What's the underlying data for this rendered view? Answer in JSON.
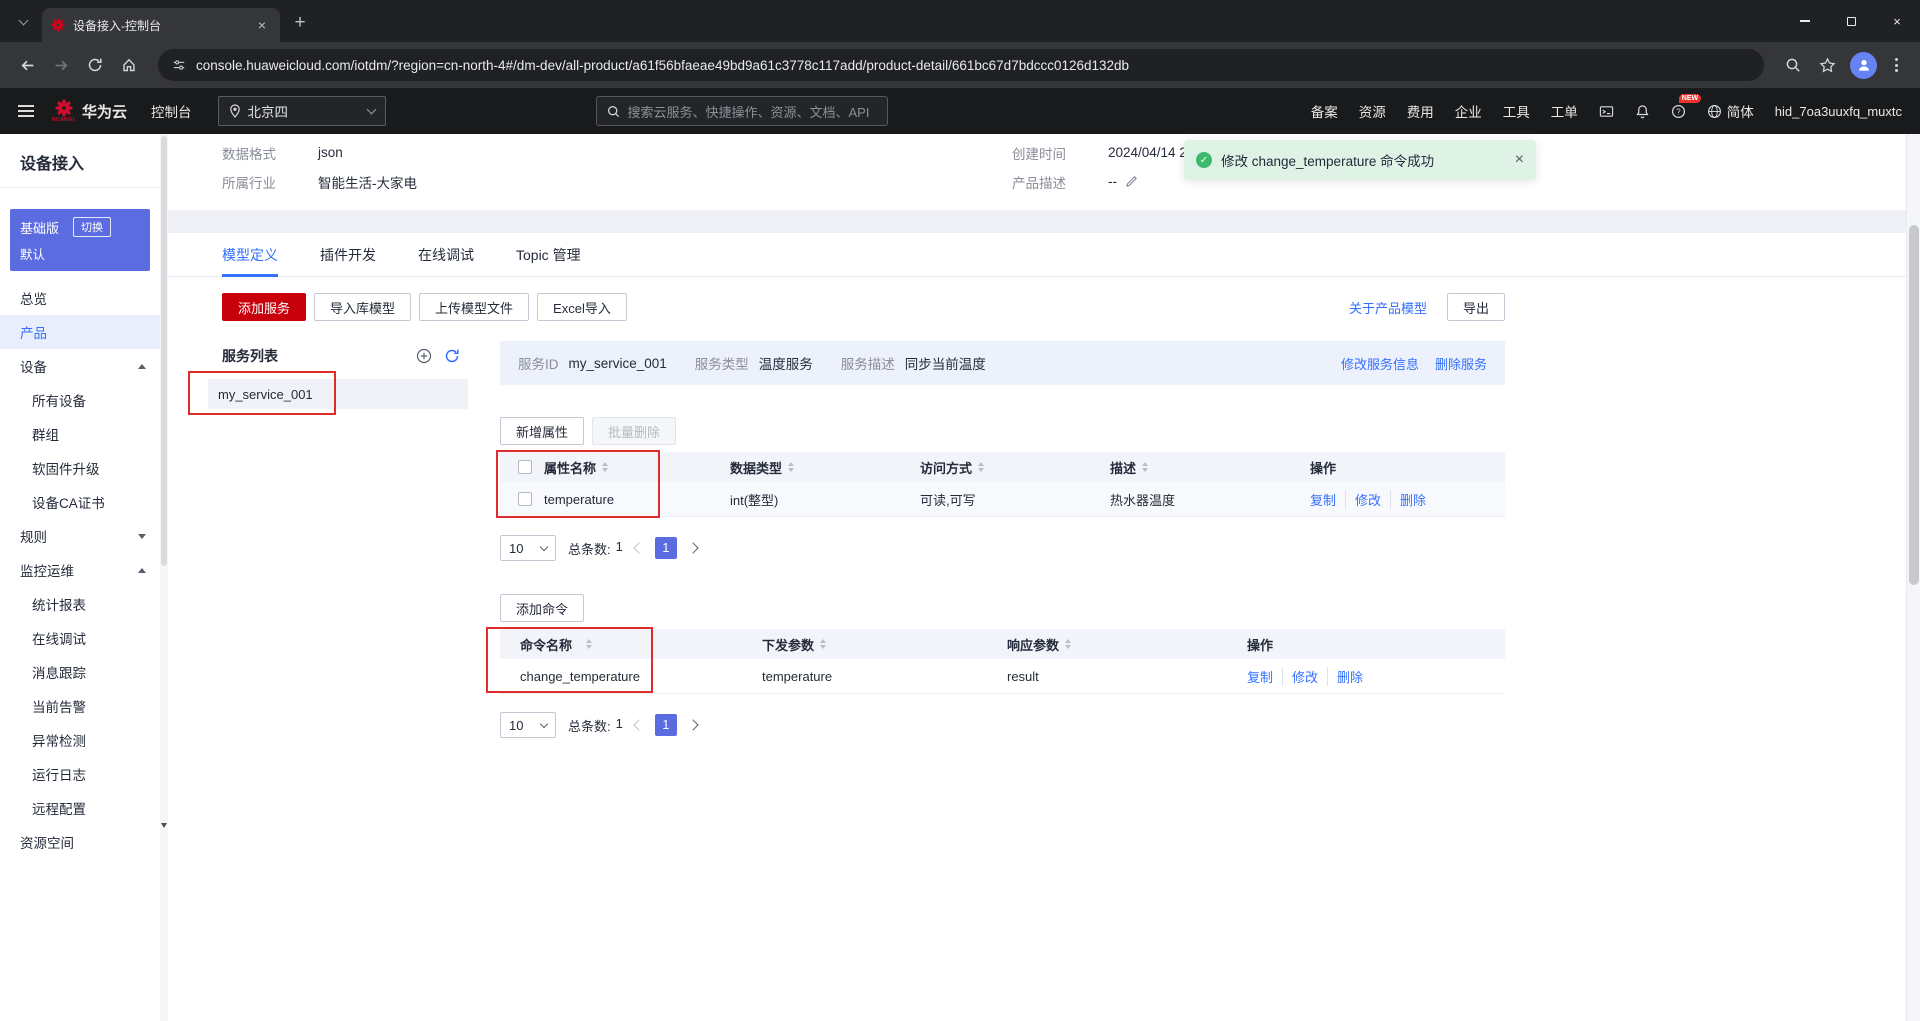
{
  "colors": {
    "accent": "#3370ff",
    "huawei-red": "#c7000b",
    "success": "#3cb96a",
    "edition-bg": "#5b6be0",
    "annotation": "#e02b2b"
  },
  "browser": {
    "tab_title": "设备接入-控制台",
    "url": "console.huaweicloud.com/iotdm/?region=cn-north-4#/dm-dev/all-product/a61f56bfaeae49bd9a61c3778c117add/product-detail/661bc67d7bdccc0126d132db"
  },
  "topnav": {
    "brand": "华为云",
    "brand_sub": "HUAWEI",
    "console": "控制台",
    "region": "北京四",
    "search_placeholder": "搜索云服务、快捷操作、资源、文档、API",
    "items": [
      "备案",
      "资源",
      "费用",
      "企业",
      "工具",
      "工单"
    ],
    "lang": "简体",
    "badge_new": "NEW",
    "account": "hid_7oa3uuxfq_muxtc"
  },
  "sidebar": {
    "title": "设备接入",
    "edition": {
      "name": "基础版",
      "switch": "切换",
      "instance": "默认"
    },
    "items": [
      {
        "label": "总览"
      },
      {
        "label": "产品"
      },
      {
        "label": "设备"
      },
      {
        "label": "所有设备"
      },
      {
        "label": "群组"
      },
      {
        "label": "软固件升级"
      },
      {
        "label": "设备CA证书"
      },
      {
        "label": "规则"
      },
      {
        "label": "监控运维"
      },
      {
        "label": "统计报表"
      },
      {
        "label": "在线调试"
      },
      {
        "label": "消息跟踪"
      },
      {
        "label": "当前告警"
      },
      {
        "label": "异常检测"
      },
      {
        "label": "运行日志"
      },
      {
        "label": "远程配置"
      },
      {
        "label": "资源空间"
      }
    ]
  },
  "product": {
    "fields": [
      {
        "label": "数据格式",
        "value": "json"
      },
      {
        "label": "创建时间",
        "value": "2024/04/14 2"
      },
      {
        "label": "所属行业",
        "value": "智能生活-大家电"
      },
      {
        "label": "产品描述",
        "value": "--"
      }
    ]
  },
  "toast": {
    "message": "修改 change_temperature 命令成功"
  },
  "tabs": [
    {
      "label": "模型定义"
    },
    {
      "label": "插件开发"
    },
    {
      "label": "在线调试"
    },
    {
      "label": "Topic 管理"
    }
  ],
  "toolbar": {
    "add_service": "添加服务",
    "import_lib": "导入库模型",
    "upload_file": "上传模型文件",
    "excel_import": "Excel导入",
    "about": "关于产品模型",
    "export": "导出"
  },
  "service_list": {
    "title": "服务列表",
    "selected": "my_service_001"
  },
  "service": {
    "fields": [
      {
        "label": "服务ID",
        "value": "my_service_001"
      },
      {
        "label": "服务类型",
        "value": "温度服务"
      },
      {
        "label": "服务描述",
        "value": "同步当前温度"
      }
    ],
    "modify": "修改服务信息",
    "delete": "删除服务"
  },
  "properties": {
    "add": "新增属性",
    "batch_delete": "批量删除",
    "columns": [
      "属性名称",
      "数据类型",
      "访问方式",
      "描述",
      "操作"
    ],
    "row": {
      "name": "temperature",
      "type": "int(整型)",
      "access": "可读,可写",
      "desc": "热水器温度"
    },
    "actions": [
      "复制",
      "修改",
      "删除"
    ],
    "page": {
      "size": "10",
      "total_label": "总条数:",
      "total": "1",
      "page": "1"
    }
  },
  "commands": {
    "add": "添加命令",
    "columns": [
      "命令名称",
      "下发参数",
      "响应参数",
      "操作"
    ],
    "row": {
      "name": "change_temperature",
      "param": "temperature",
      "response": "result"
    },
    "actions": [
      "复制",
      "修改",
      "删除"
    ],
    "page": {
      "size": "10",
      "total_label": "总条数:",
      "total": "1",
      "page": "1"
    }
  }
}
